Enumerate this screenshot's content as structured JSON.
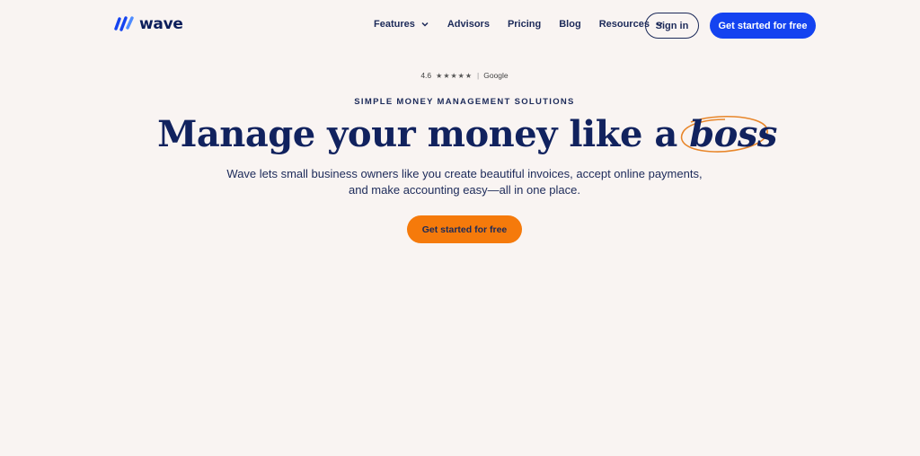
{
  "brand": {
    "name": "wave",
    "accent": "#1443f0",
    "cta_color": "#f57a0b",
    "text_color": "#1c2a59"
  },
  "nav": {
    "links": [
      {
        "label": "Features",
        "has_dropdown": true
      },
      {
        "label": "Advisors",
        "has_dropdown": false
      },
      {
        "label": "Pricing",
        "has_dropdown": false
      },
      {
        "label": "Blog",
        "has_dropdown": false
      },
      {
        "label": "Resources",
        "has_dropdown": true
      }
    ],
    "sign_in": "Sign in",
    "get_started": "Get started for free"
  },
  "hero": {
    "rating_value": "4.6",
    "rating_stars": "★★★★★",
    "rating_source": "Google",
    "eyebrow": "SIMPLE MONEY MANAGEMENT SOLUTIONS",
    "headline_main": "Manage your money like a ",
    "headline_emphasis": "boss",
    "subtitle_line1": "Wave lets small business owners like you create beautiful invoices, accept online payments,",
    "subtitle_line2": "and make accounting easy—all in one place.",
    "cta": "Get started for free"
  }
}
